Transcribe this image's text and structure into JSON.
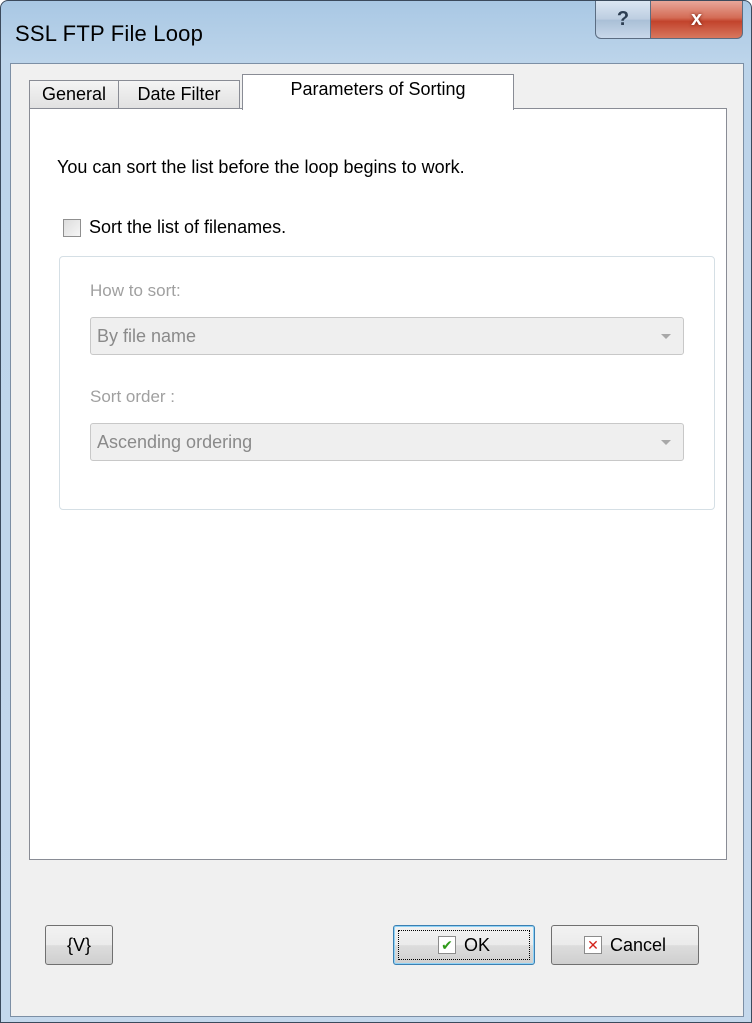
{
  "window": {
    "title": "SSL FTP File Loop",
    "help_glyph": "?",
    "close_glyph": "x"
  },
  "tabs": [
    {
      "label": "General",
      "active": false
    },
    {
      "label": "Date Filter",
      "active": false
    },
    {
      "label": "Parameters of Sorting",
      "active": true
    }
  ],
  "page": {
    "intro": "You can sort the list before the loop begins to work.",
    "sort_checkbox": {
      "label": "Sort the list of filenames.",
      "checked": false
    },
    "how_to_sort": {
      "label": "How to sort:",
      "value": "By file name",
      "enabled": false
    },
    "sort_order": {
      "label": "Sort order :",
      "value": "Ascending ordering",
      "enabled": false
    }
  },
  "buttons": {
    "variables": "{V}",
    "ok": "OK",
    "cancel": "Cancel"
  },
  "icons": {
    "help": "help-icon",
    "close": "close-icon",
    "ok": "checkmark-icon",
    "cancel": "x-icon",
    "dropdown": "chevron-down-icon"
  }
}
